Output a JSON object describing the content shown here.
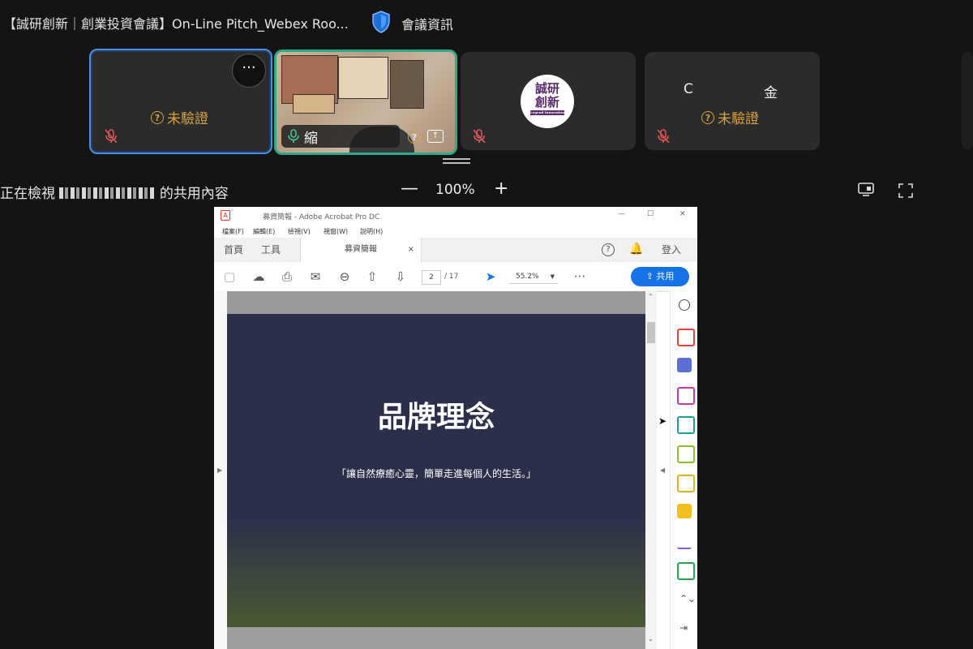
{
  "meeting": {
    "title": "【誠研創新｜創業投資會議】On-Line Pitch_Webex Roo...",
    "info_label": "會議資訊"
  },
  "tiles": [
    {
      "status": "未驗證",
      "more_label": "···"
    },
    {
      "name": "縮"
    },
    {
      "logo_line1": "誠研",
      "logo_line2": "創新",
      "logo_tag": "Legend Innovation"
    },
    {
      "name_left": "C",
      "name_right": "金",
      "status": "未驗證"
    }
  ],
  "share_bar": {
    "label_prefix": "正在檢視",
    "label_suffix": "的共用內容",
    "zoom_minus": "—",
    "zoom_value": "100%",
    "zoom_plus": "+"
  },
  "acrobat": {
    "window_title": "募資簡報 - Adobe Acrobat Pro DC",
    "menu": [
      "檔案(F)",
      "編輯(E)",
      "檢視(V)",
      "視窗(W)",
      "說明(H)"
    ],
    "tab_home": "首頁",
    "tab_tools": "工具",
    "doc_tab": "募資簡報",
    "doc_tab_close": "×",
    "login_label": "登入",
    "page_current": "2",
    "page_total": "/ 17",
    "zoom": "55.2%",
    "share_label": "共用",
    "win_min": "—",
    "win_max": "☐",
    "win_close": "✕"
  },
  "slide": {
    "title": "品牌理念",
    "subtitle": "「讓自然療癒心靈，簡單走進每個人的生活。」"
  },
  "colors": {
    "background": "#141414",
    "status_warn": "#d9a23a",
    "active_speaker": "#2fa98a",
    "self_border": "#4a8fe0",
    "acrobat_blue": "#1473e6",
    "slide_bg": "#2c2f4a"
  }
}
